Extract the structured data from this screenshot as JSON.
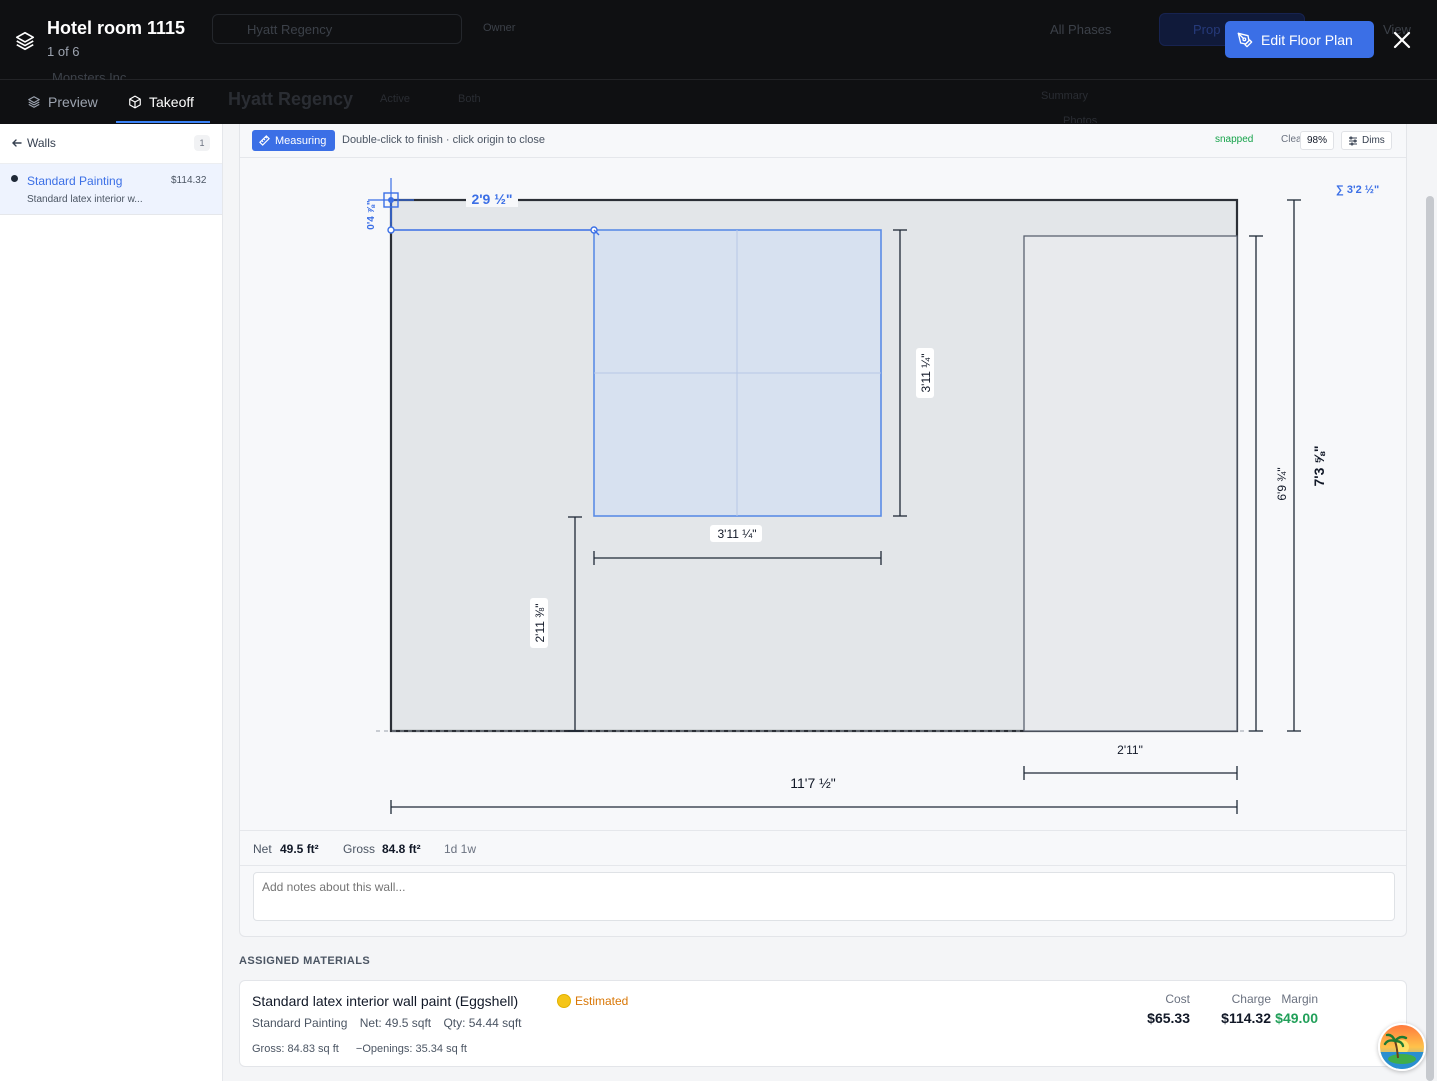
{
  "header": {
    "title": "Hotel room 1115",
    "subtitle": "1 of 6",
    "edit_button": "Edit Floor Plan",
    "background_text": {
      "hotel": "Hyatt Regency",
      "role": "Owner",
      "org": "Monsters Inc.",
      "phases": "All Phases",
      "proposal": "Prop",
      "view": "View",
      "project": "Hyatt Regency",
      "status": "Active",
      "both": "Both",
      "summary": "Summary",
      "photos": "Photos"
    }
  },
  "tabs": [
    {
      "label": "Preview",
      "icon": "layers-icon"
    },
    {
      "label": "Takeoff",
      "icon": "cube-icon"
    }
  ],
  "sidebar": {
    "back_label": "Walls",
    "count": "1",
    "items": [
      {
        "name": "Standard Painting",
        "price": "$114.32",
        "description": "Standard latex interior w..."
      }
    ]
  },
  "toolbar": {
    "measuring_label": "Measuring",
    "hint": "Double-click to finish · click origin to close",
    "snapped": "snapped",
    "clear": "Clear",
    "zoom": "98%",
    "dims": "Dims"
  },
  "drawing": {
    "measure_length": "2'9 ½\"",
    "measure_rise": "0'4 ⅞\"",
    "measure_total": "∑ 3'2 ½\"",
    "window_height": "3'11 ¼\"",
    "window_width": "3'11 ¼\"",
    "sill_height": "2'11 ⅜\"",
    "door_height": "6'9 ¾\"",
    "wall_height": "7'3 ⅝\"",
    "door_width": "2'11\"",
    "wall_width": "11'7 ½\""
  },
  "stats": {
    "net_label": "Net",
    "net_value": "49.5 ft²",
    "gross_label": "Gross",
    "gross_value": "84.8 ft²",
    "openings": "1d 1w"
  },
  "notes": {
    "placeholder": "Add notes about this wall..."
  },
  "assigned": {
    "heading": "ASSIGNED MATERIALS",
    "material": {
      "name": "Standard latex interior wall paint (Eggshell)",
      "status": "Estimated",
      "category": "Standard Painting",
      "net": "Net: 49.5 sqft",
      "qty": "Qty: 54.44 sqft",
      "gross": "Gross: 84.83 sq ft",
      "openings": "−Openings: 35.34 sq ft",
      "cost_label": "Cost",
      "cost_value": "$65.33",
      "charge_label": "Charge",
      "charge_value": "$114.32",
      "margin_label": "Margin",
      "margin_value": "$49.00"
    }
  },
  "colors": {
    "accent": "#3b6fe6",
    "dark_bg": "#0f1012",
    "success": "#22a05a",
    "warning": "#d97706"
  }
}
